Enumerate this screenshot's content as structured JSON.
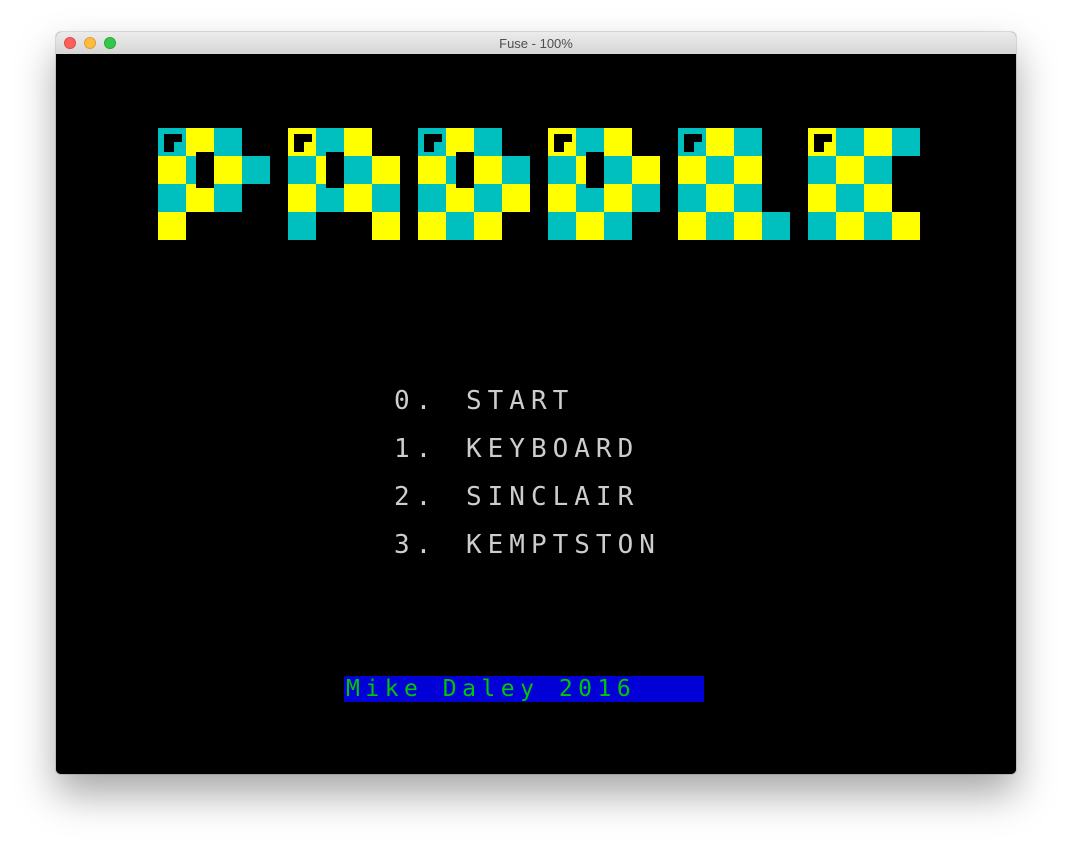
{
  "window": {
    "title": "Fuse - 100%"
  },
  "game": {
    "logo_text": "PADDLE",
    "menu": [
      {
        "key": "0.",
        "label": "START"
      },
      {
        "key": "1.",
        "label": "KEYBOARD"
      },
      {
        "key": "2.",
        "label": "SINCLAIR"
      },
      {
        "key": "3.",
        "label": "KEMPTSTON"
      }
    ],
    "credit": "Mike Daley 2016"
  },
  "colors": {
    "cyan": "#00bfbf",
    "yellow": "#ffff00",
    "screen_bg": "#000000",
    "menu_text": "#cdcdcd",
    "credit_bg": "#0000d7",
    "credit_text": "#00c800"
  }
}
